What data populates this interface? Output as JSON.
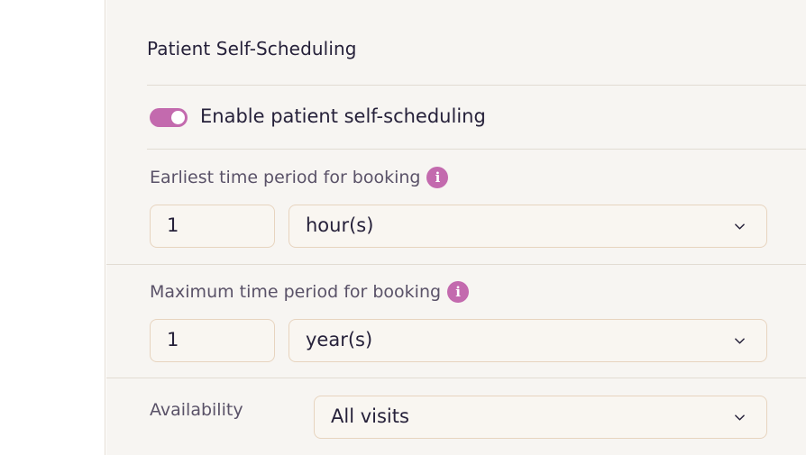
{
  "section": {
    "title": "Patient Self-Scheduling"
  },
  "toggle": {
    "label": "Enable patient self-scheduling",
    "enabled": true
  },
  "earliest": {
    "label": "Earliest time period for booking",
    "value": "1",
    "unit": "hour(s)"
  },
  "maximum": {
    "label": "Maximum time period for booking",
    "value": "1",
    "unit": "year(s)"
  },
  "availability": {
    "label": "Availability",
    "value": "All visits"
  },
  "icons": {
    "info": "i",
    "chevron": "chevron-down-icon"
  },
  "colors": {
    "accent": "#c36aae",
    "panel_bg": "#f7f5f2",
    "field_border": "#e7d4bf",
    "text_dark": "#26213a",
    "text_label": "#5a5268"
  }
}
